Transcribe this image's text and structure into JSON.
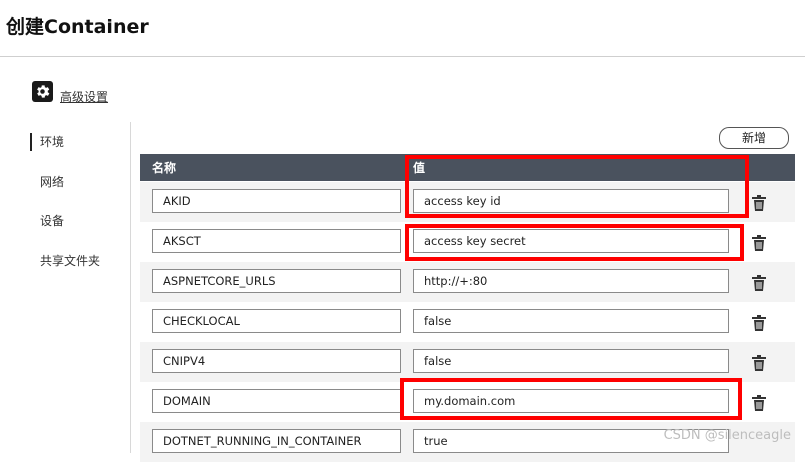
{
  "page": {
    "title": "创建Container"
  },
  "advanced": {
    "label": "高级设置",
    "icon": "gear-icon"
  },
  "nav": {
    "items": [
      {
        "label": "环境",
        "active": true
      },
      {
        "label": "网络",
        "active": false
      },
      {
        "label": "设备",
        "active": false
      },
      {
        "label": "共享文件夹",
        "active": false
      }
    ]
  },
  "toolbar": {
    "add_label": "新增"
  },
  "table": {
    "headers": {
      "name": "名称",
      "value": "值"
    },
    "rows": [
      {
        "name": "AKID",
        "value": "access key id"
      },
      {
        "name": "AKSCT",
        "value": "access key secret"
      },
      {
        "name": "ASPNETCORE_URLS",
        "value": "http://+:80"
      },
      {
        "name": "CHECKLOCAL",
        "value": "false"
      },
      {
        "name": "CNIPV4",
        "value": "false"
      },
      {
        "name": "DOMAIN",
        "value": "my.domain.com"
      },
      {
        "name": "DOTNET_RUNNING_IN_CONTAINER",
        "value": "true"
      }
    ]
  },
  "watermark": "CSDN @silenceagle",
  "colors": {
    "header_bg": "#4a525e",
    "highlight": "#ff0000"
  }
}
